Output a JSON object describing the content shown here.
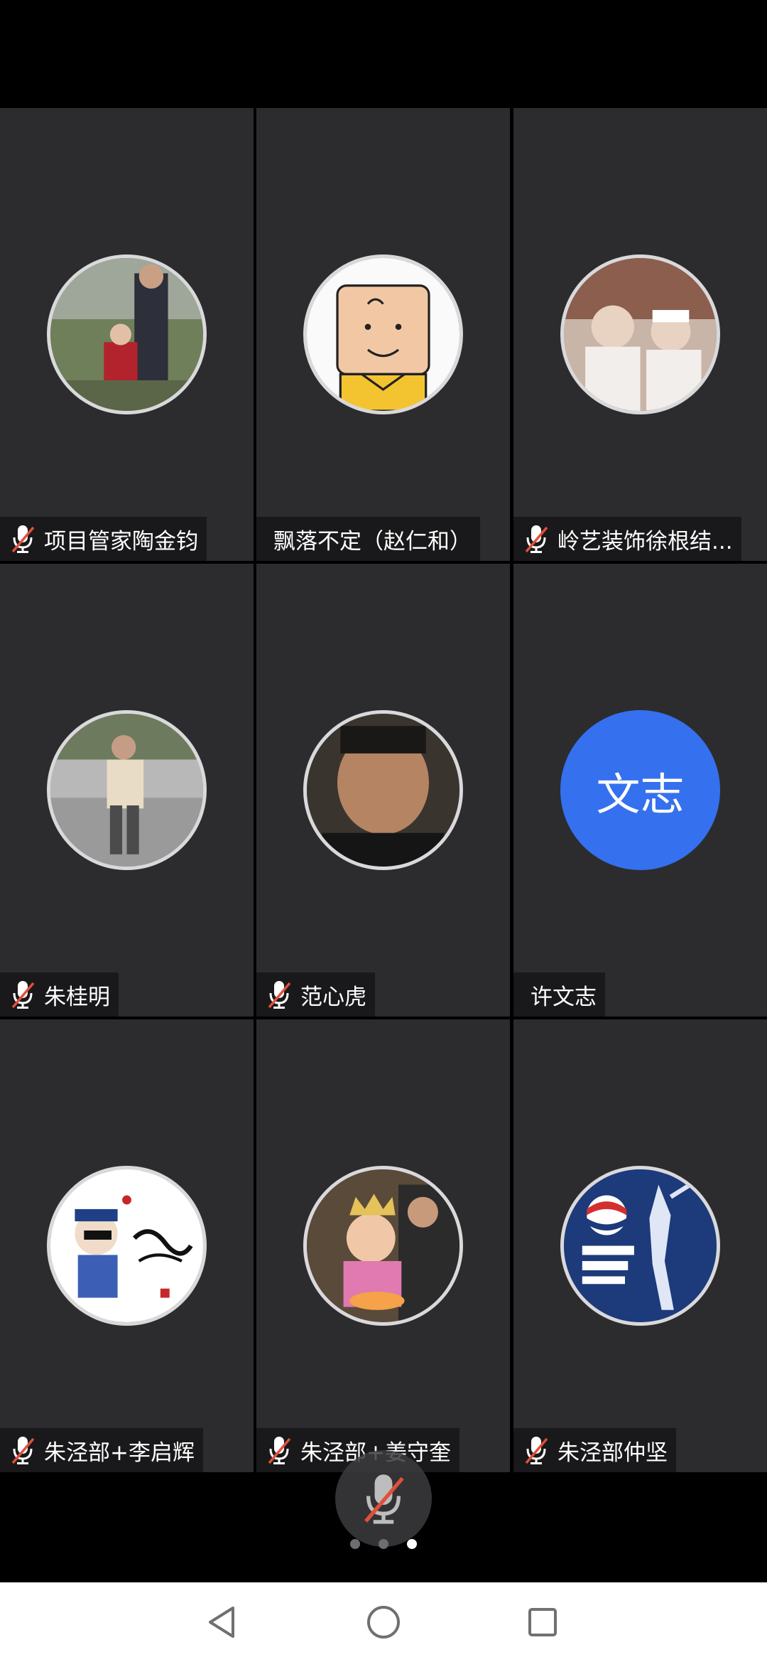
{
  "participants": [
    {
      "name": "项目管家陶金钧",
      "muted": true,
      "avatar": "photo-man-with-child"
    },
    {
      "name": "飘落不定（赵仁和）",
      "muted": false,
      "avatar": "cartoon-charlie-brown"
    },
    {
      "name": "岭艺装饰徐根结...",
      "muted": true,
      "avatar": "photo-two-women"
    },
    {
      "name": "朱桂明",
      "muted": true,
      "avatar": "photo-man-standing"
    },
    {
      "name": "范心虎",
      "muted": true,
      "avatar": "photo-man-selfie"
    },
    {
      "name": "许文志",
      "muted": false,
      "avatar_initials": "文志"
    },
    {
      "name": "朱泾部+李启辉",
      "muted": true,
      "avatar": "cartoon-calligraphy"
    },
    {
      "name": "朱泾部+姜守奎",
      "muted": true,
      "avatar": "photo-child-with-crown"
    },
    {
      "name": "朱泾部仲坚",
      "muted": true,
      "avatar": "pepsi-king-of-pop"
    }
  ],
  "pagination": {
    "pages": 3,
    "current": 3
  },
  "colors": {
    "tile_bg": "#2c2c2e",
    "initials_avatar": "#3570ee",
    "muted_icon": "#e0503a"
  }
}
